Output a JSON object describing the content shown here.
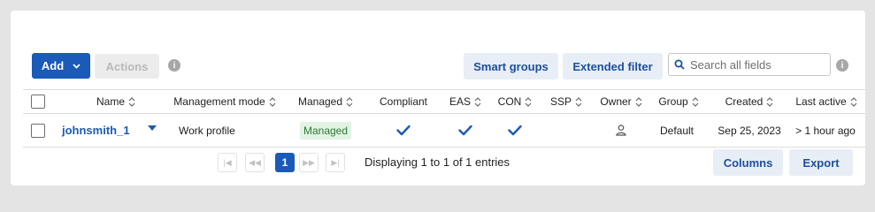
{
  "toolbar": {
    "add_label": "Add",
    "actions_label": "Actions",
    "smart_groups_label": "Smart groups",
    "extended_filter_label": "Extended filter",
    "search_placeholder": "Search all fields",
    "search_value": ""
  },
  "table": {
    "columns": [
      "Name",
      "Management mode",
      "Managed",
      "Compliant",
      "EAS",
      "CON",
      "SSP",
      "Owner",
      "Group",
      "Created",
      "Last active"
    ],
    "rows": [
      {
        "name": "johnsmith_1",
        "management_mode": "Work profile",
        "managed": "Managed",
        "compliant": true,
        "eas": true,
        "con": true,
        "ssp": false,
        "owner_icon": "person-icon",
        "group": "Default",
        "created": "Sep 25, 2023",
        "last_active": "> 1 hour ago"
      }
    ]
  },
  "pagination": {
    "first": "|◀",
    "prev": "◀◀",
    "current_page": "1",
    "next": "▶▶",
    "last": "▶|",
    "summary": "Displaying 1 to 1 of 1 entries"
  },
  "footer": {
    "columns_label": "Columns",
    "export_label": "Export"
  },
  "colors": {
    "primary": "#1a5ab8",
    "link": "#1c5ab2",
    "managed_badge_bg": "#e2f3e3",
    "managed_badge_text": "#2a7a35",
    "background": "#e4e4e4"
  }
}
